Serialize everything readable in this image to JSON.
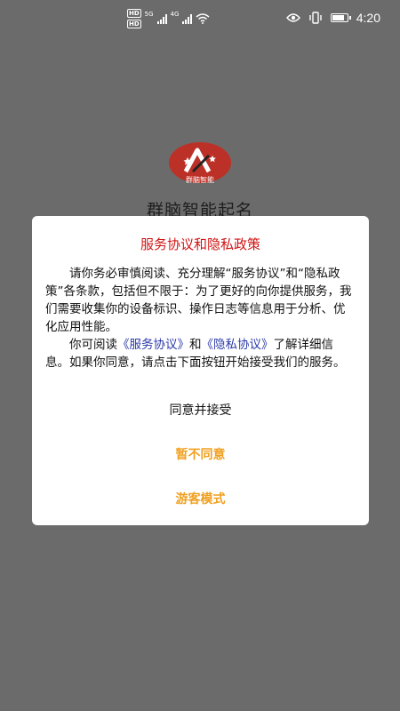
{
  "status_bar": {
    "hd_1": "HD",
    "hd_2": "HD",
    "net_1": "5G",
    "net_2": "4G",
    "time": "4:20",
    "eye_icon": "eye-icon",
    "vibrate_icon": "vibrate-icon",
    "battery_icon": "battery-icon"
  },
  "app": {
    "logo_text": "群脑智能",
    "name": "群脑智能起名"
  },
  "dialog": {
    "title": "服务协议和隐私政策",
    "para1": "请你务必审慎阅读、充分理解“服务协议”和“隐私政策”各条款，包括但不限于：为了更好的向你提供服务，我们需要收集你的设备标识、操作日志等信息用于分析、优化应用性能。",
    "para2_prefix": "你可阅读",
    "link_service": "《服务协议》",
    "para2_and": "和",
    "link_privacy": "《隐私协议》",
    "para2_suffix": "了解详细信息。如果你同意，请点击下面按钮开始接受我们的服务。",
    "accept_label": "同意并接受",
    "decline_label": "暂不同意",
    "guest_label": "游客模式"
  },
  "colors": {
    "overlay": "#6b6b6b",
    "title_red": "#d01414",
    "link_blue": "#2b3aa8",
    "accent_orange": "#f0a020"
  }
}
